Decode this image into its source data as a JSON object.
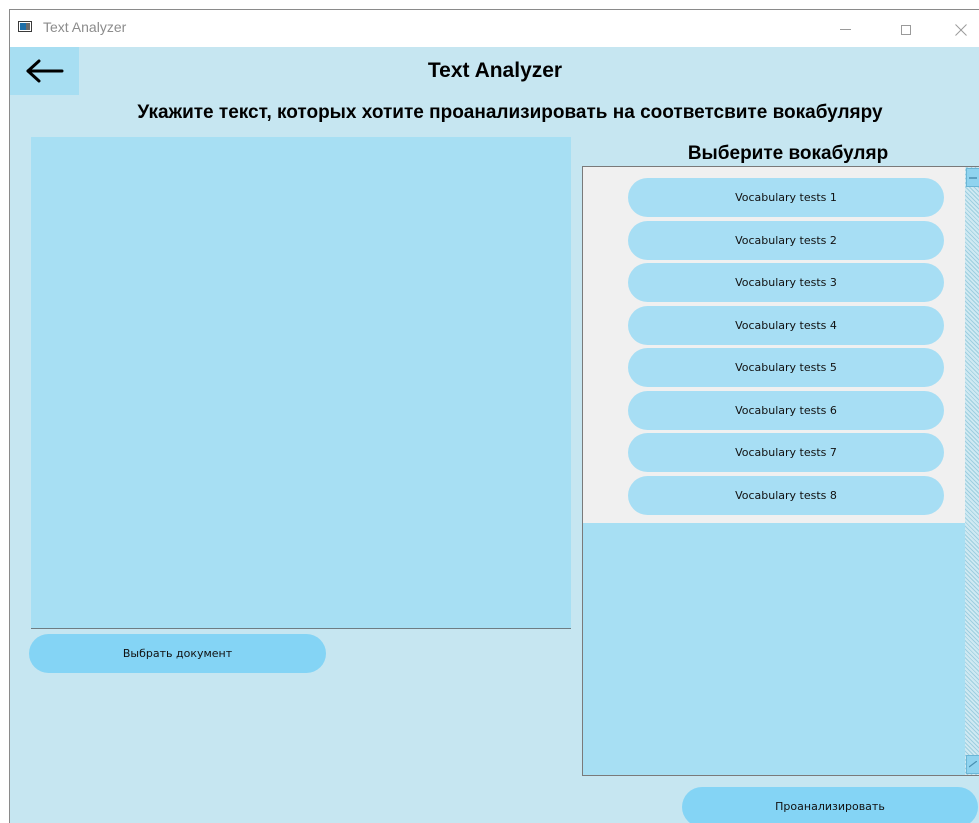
{
  "window": {
    "title": "Text Analyzer"
  },
  "header": {
    "app_title": "Text Analyzer",
    "instruction": "Укажите текст, которых хотите проанализировать на соответсвите вокабуляру"
  },
  "text_input": {
    "value": ""
  },
  "buttons": {
    "choose_document": "Выбрать документ",
    "analyze": "Проанализировать"
  },
  "vocabulary": {
    "heading": "Выберите вокабуляр",
    "items": [
      {
        "label": "Vocabulary tests 1"
      },
      {
        "label": "Vocabulary tests 2"
      },
      {
        "label": "Vocabulary tests 3"
      },
      {
        "label": "Vocabulary tests 4"
      },
      {
        "label": "Vocabulary tests 5"
      },
      {
        "label": "Vocabulary tests 6"
      },
      {
        "label": "Vocabulary tests 7"
      },
      {
        "label": "Vocabulary tests 8"
      }
    ]
  },
  "icons": {
    "back": "arrow-left-icon",
    "app": "app-window-icon",
    "minimize": "minimize-icon",
    "maximize": "maximize-icon",
    "close": "close-icon",
    "scroll_up": "scroll-up-icon",
    "scroll_down": "scroll-down-icon"
  },
  "colors": {
    "background": "#c6e6f1",
    "text_area": "#a7dff3",
    "button": "#84d4f5",
    "vocab_button": "#a7def4",
    "list_background": "#f0f0f0"
  }
}
